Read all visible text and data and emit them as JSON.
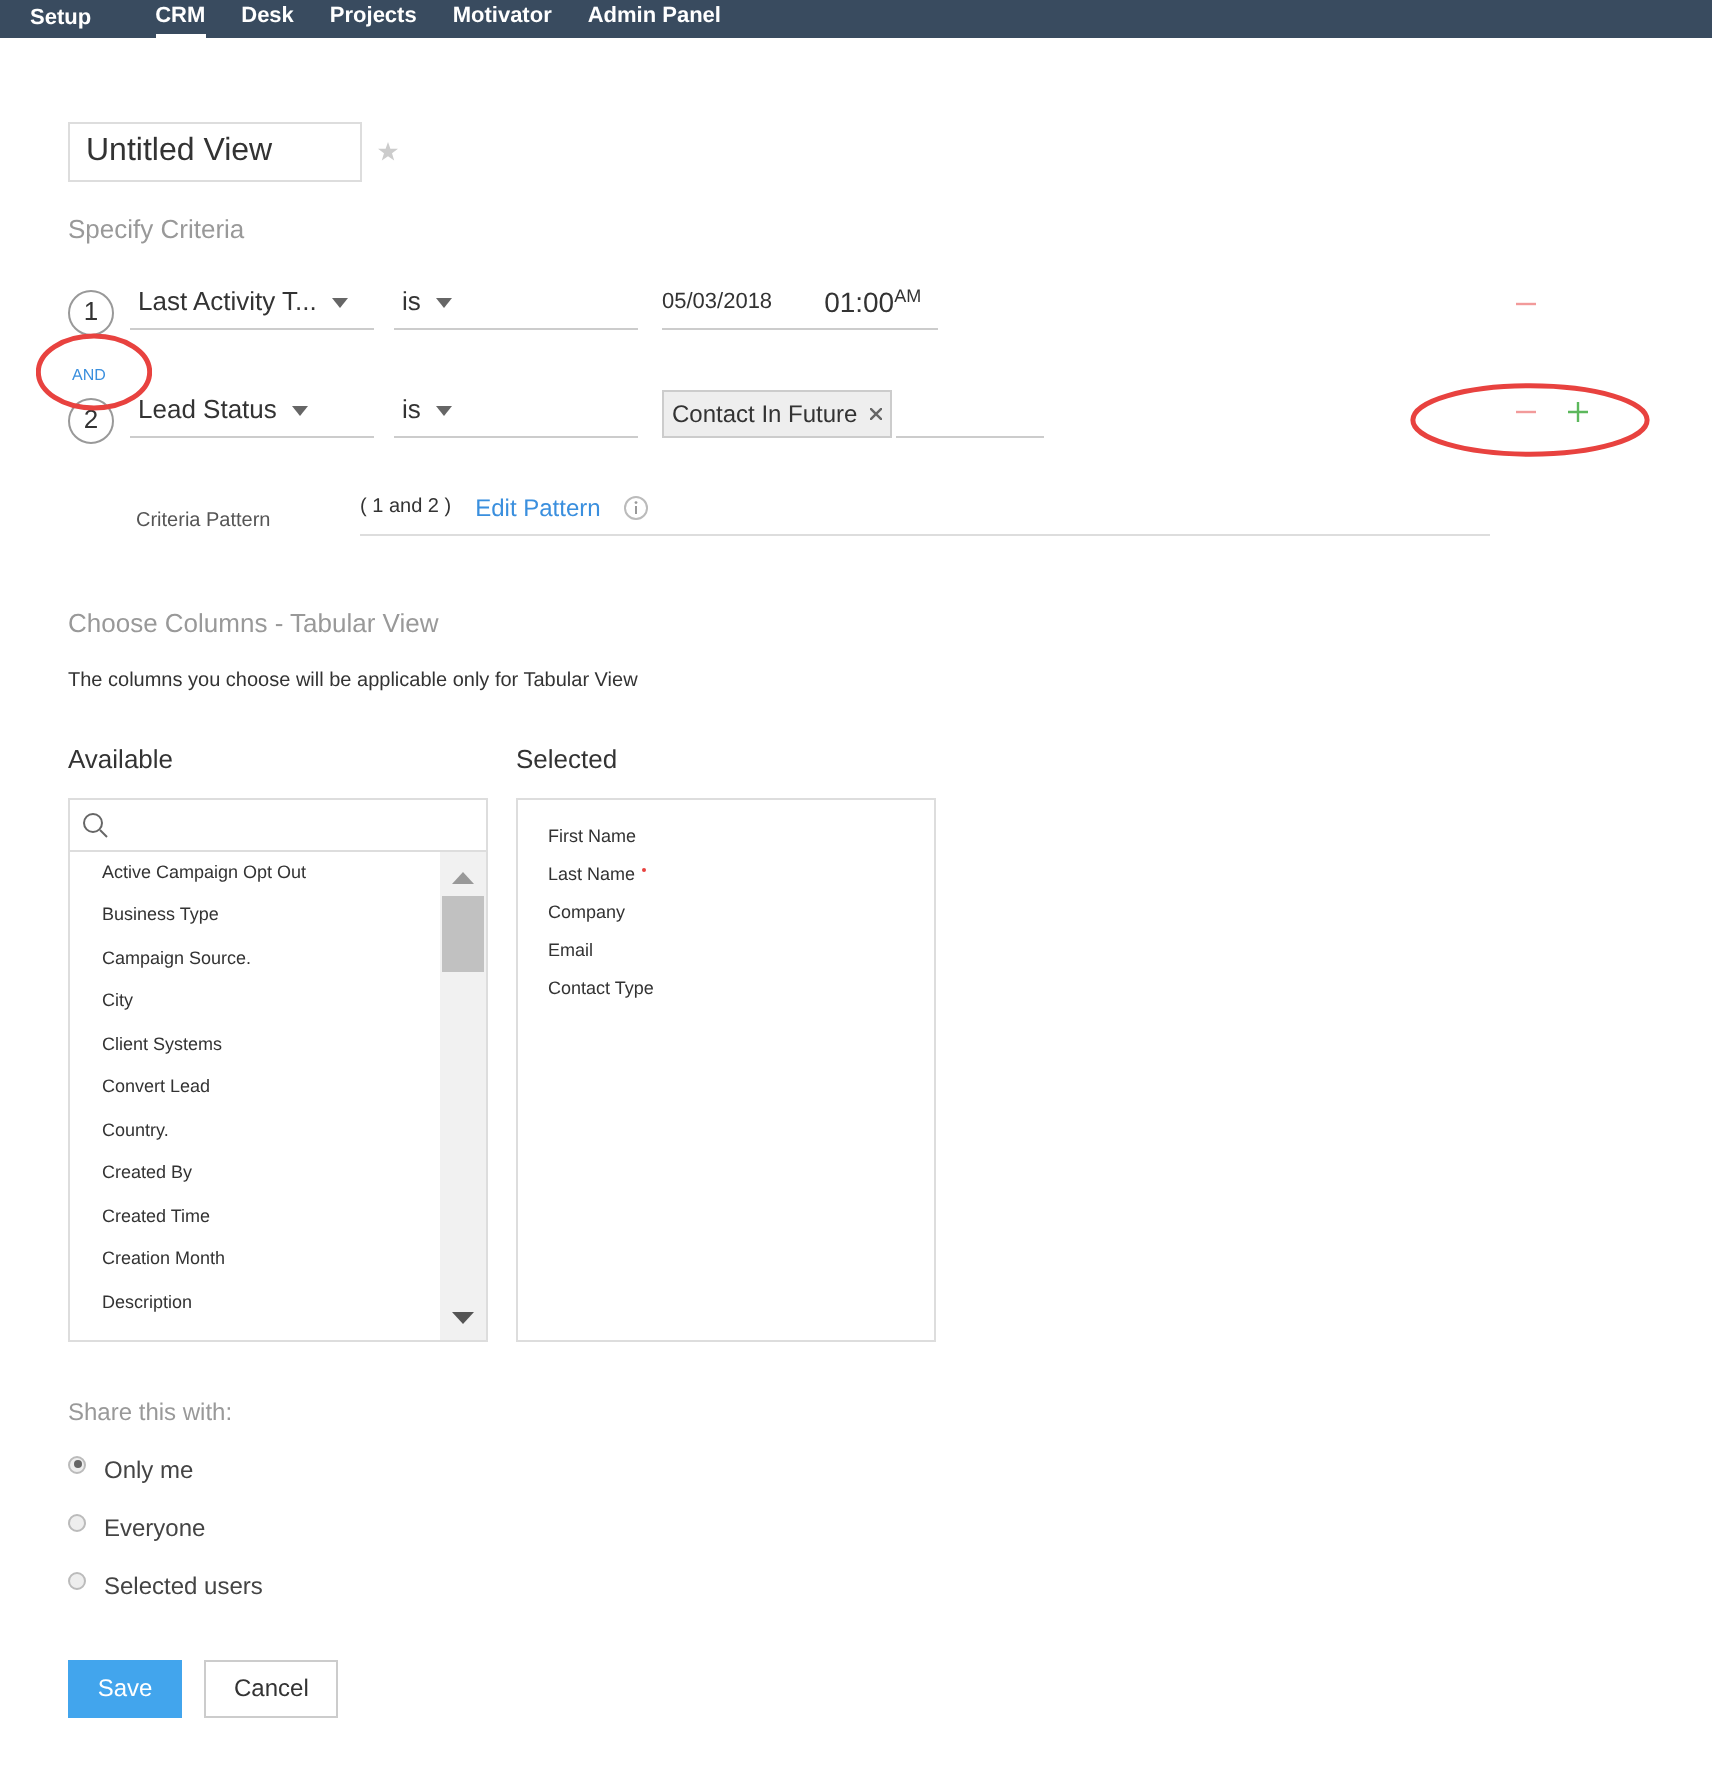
{
  "nav": {
    "title": "Setup",
    "tabs": [
      {
        "label": "CRM",
        "selected": true
      },
      {
        "label": "Desk",
        "selected": false
      },
      {
        "label": "Projects",
        "selected": false
      },
      {
        "label": "Motivator",
        "selected": false
      },
      {
        "label": "Admin Panel",
        "selected": false
      }
    ]
  },
  "view_name": {
    "value": "Untitled View",
    "favorite": false
  },
  "criteria": {
    "heading": "Specify Criteria",
    "connector": "AND",
    "rows": [
      {
        "number": "1",
        "field": "Last Activity T...",
        "operator": "is",
        "kind": "datetime",
        "date": "05/03/2018",
        "time": "01:00",
        "meridiem": "AM",
        "can_add": false
      },
      {
        "number": "2",
        "field": "Lead Status",
        "operator": "is",
        "kind": "tags",
        "tags": [
          "Contact In Future"
        ],
        "can_add": true
      }
    ],
    "pattern_label": "Criteria Pattern",
    "pattern": "( 1 and 2 )",
    "edit_link": "Edit Pattern"
  },
  "columns": {
    "heading": "Choose Columns - Tabular View",
    "note": "The columns you choose will be applicable only for Tabular View",
    "available_title": "Available",
    "available": [
      "Active Campaign Opt Out",
      "Business Type",
      "Campaign Source.",
      "City",
      "Client Systems",
      "Convert Lead",
      "Country.",
      "Created By",
      "Created Time",
      "Creation Month",
      "Description"
    ],
    "selected_title": "Selected",
    "selected": [
      {
        "label": "First Name",
        "required": false
      },
      {
        "label": "Last Name",
        "required": true
      },
      {
        "label": "Company",
        "required": false
      },
      {
        "label": "Email",
        "required": false
      },
      {
        "label": "Contact Type",
        "required": false
      }
    ]
  },
  "share": {
    "heading": "Share this with:",
    "options": [
      {
        "label": "Only me",
        "selected": true
      },
      {
        "label": "Everyone",
        "selected": false
      },
      {
        "label": "Selected users",
        "selected": false
      }
    ]
  },
  "buttons": [
    {
      "label": "Save",
      "kind": "primary"
    },
    {
      "label": "Cancel",
      "kind": "secondary"
    }
  ]
}
